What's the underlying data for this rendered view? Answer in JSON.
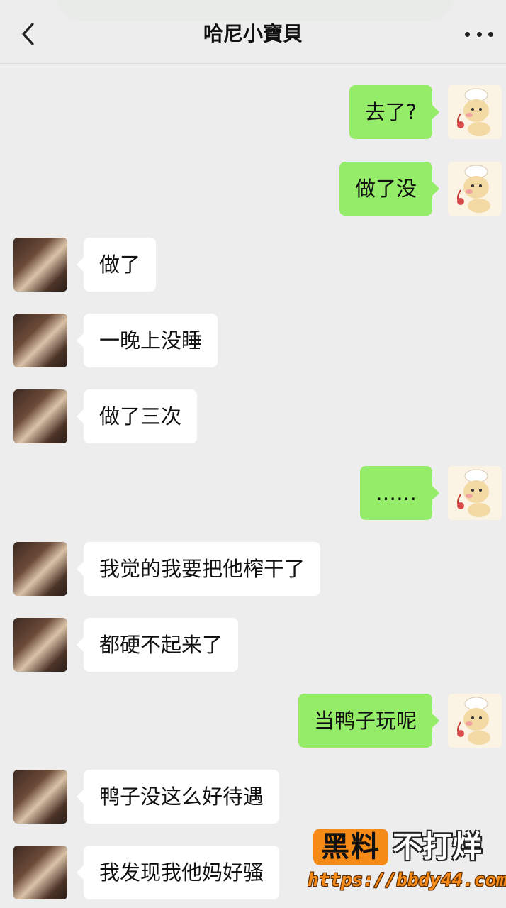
{
  "header": {
    "title": "哈尼小寶貝",
    "back_icon": "chevron-left-icon",
    "more_icon": "more-dots-icon"
  },
  "messages": [
    {
      "side": "right",
      "text": "去了?"
    },
    {
      "side": "right",
      "text": "做了没"
    },
    {
      "side": "left",
      "text": "做了"
    },
    {
      "side": "left",
      "text": "一晚上没睡"
    },
    {
      "side": "left",
      "text": "做了三次"
    },
    {
      "side": "right",
      "text": "……"
    },
    {
      "side": "left",
      "text": "我觉的我要把他榨干了"
    },
    {
      "side": "left",
      "text": "都硬不起来了"
    },
    {
      "side": "right",
      "text": "当鸭子玩呢"
    },
    {
      "side": "left",
      "text": "鸭子没这么好待遇"
    },
    {
      "side": "left",
      "text": "我发现我他妈好骚"
    }
  ],
  "watermark": {
    "logo_text": "黑料",
    "tagline": "不打烊",
    "url": "https://bbdy44.com"
  },
  "colors": {
    "background": "#ededed",
    "outgoing_bubble": "#95ec69",
    "incoming_bubble": "#ffffff",
    "watermark_orange": "#f58a16"
  }
}
